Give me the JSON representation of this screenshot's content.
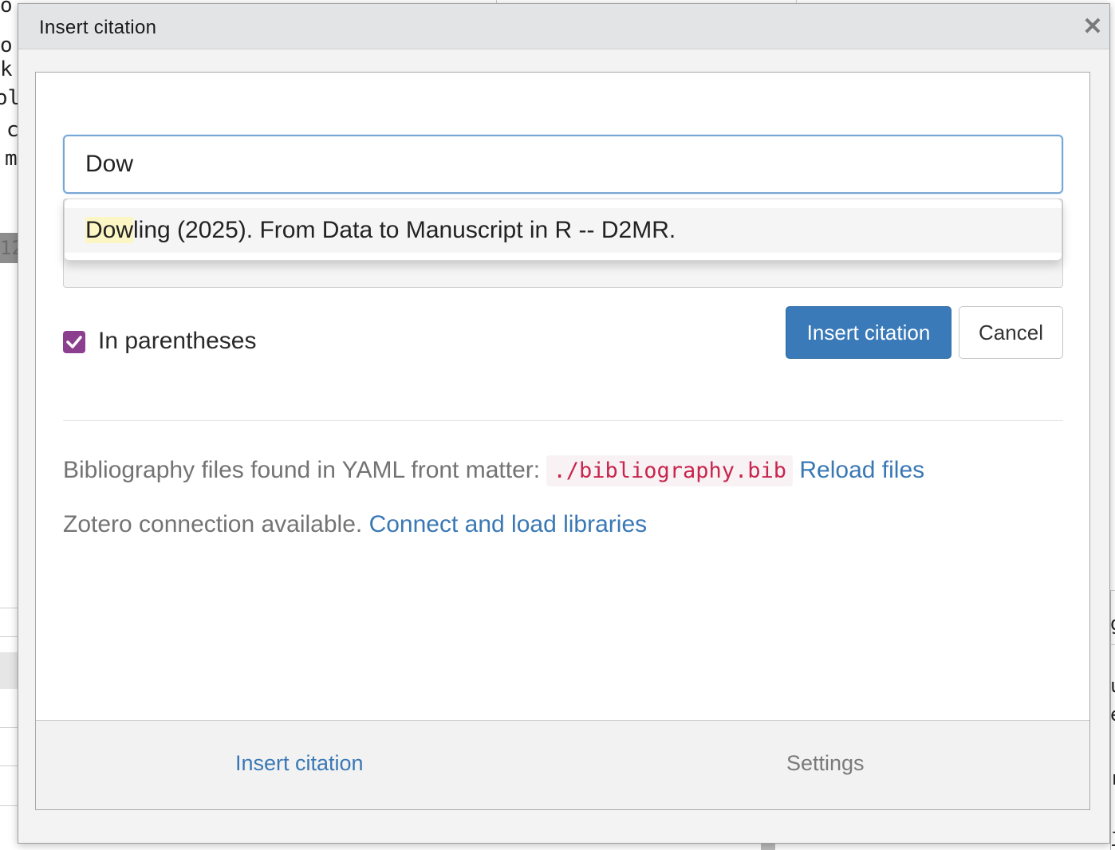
{
  "background": {
    "left_chars": [
      "o",
      "o",
      "k",
      "ol",
      "c",
      "m"
    ],
    "left_highlight": "12",
    "right_chars": [
      "g",
      "u",
      "e",
      "r",
      "j"
    ]
  },
  "dialog": {
    "title": "Insert citation",
    "close_icon": "close-icon",
    "search": {
      "value": "Dow",
      "placeholder": ""
    },
    "suggestion": {
      "match": "Dow",
      "rest": "ling (2025). From Data to Manuscript in R -- D2MR."
    },
    "in_parentheses": {
      "label": "In parentheses",
      "checked": true,
      "color": "#8c3f8f"
    },
    "buttons": {
      "insert": "Insert citation",
      "cancel": "Cancel",
      "primary_color": "#3a7ab8"
    },
    "bibliography": {
      "prefix": "Bibliography files found in YAML front matter:",
      "file": "./bibliography.bib",
      "reload": "Reload files"
    },
    "zotero": {
      "text": "Zotero connection available.",
      "link": "Connect and load libraries"
    },
    "footer_tabs": {
      "insert": "Insert citation",
      "settings": "Settings"
    },
    "link_color": "#3a78b5"
  }
}
